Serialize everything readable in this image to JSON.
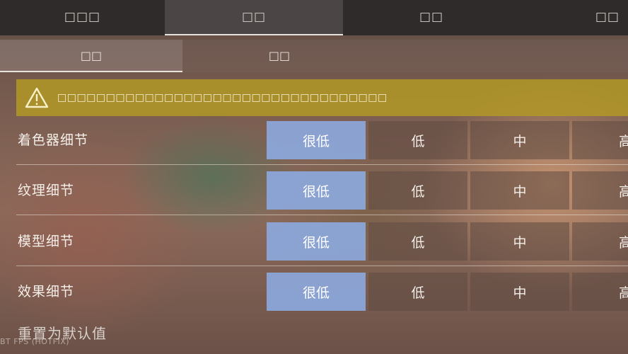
{
  "top_tabs": [
    "□□□",
    "□□",
    "□□",
    "□□"
  ],
  "active_top_tab": 1,
  "sub_tabs": [
    "□□",
    "□□"
  ],
  "active_sub_tab": 0,
  "warning": {
    "icon": "warning-triangle-icon",
    "text": "□□□□□□□□□□□□□□□□□□□□□□□□□□□□□□□□□□"
  },
  "settings": [
    {
      "label": "着色器细节",
      "options": [
        "很低",
        "低",
        "中",
        "高"
      ],
      "selected": 0
    },
    {
      "label": "纹理细节",
      "options": [
        "很低",
        "低",
        "中",
        "高"
      ],
      "selected": 0
    },
    {
      "label": "模型细节",
      "options": [
        "很低",
        "低",
        "中",
        "高"
      ],
      "selected": 0
    },
    {
      "label": "效果细节",
      "options": [
        "很低",
        "低",
        "中",
        "高"
      ],
      "selected": 0
    }
  ],
  "reset_label": "重置为默认值",
  "fps_overlay": "BT FPS (HOTFIX)",
  "colors": {
    "selected_option": "#8ca8dc",
    "warning_bg": "#b0962a",
    "top_bar": "#2e2b2a"
  }
}
